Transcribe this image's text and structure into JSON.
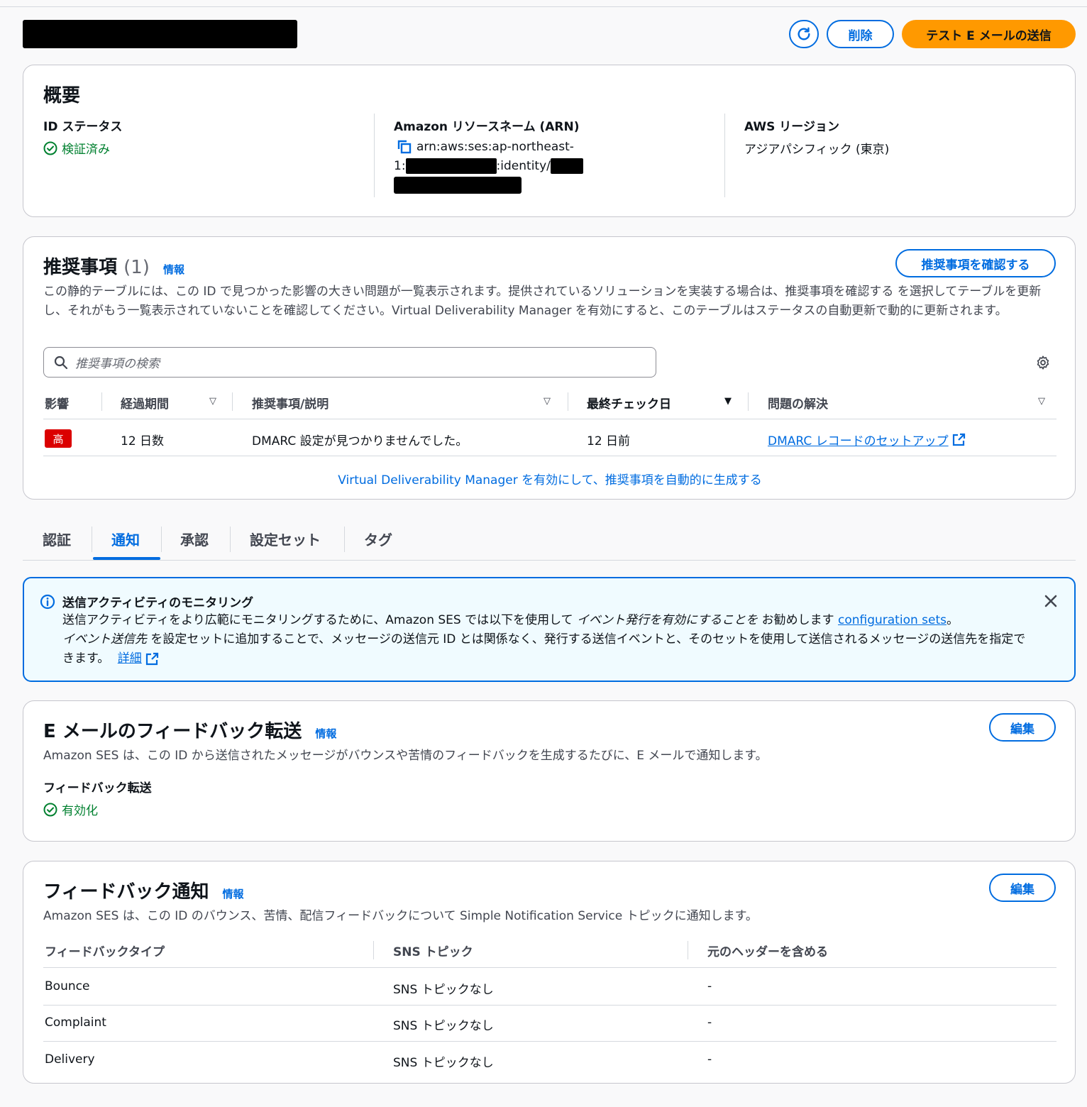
{
  "header": {
    "delete_label": "削除",
    "send_test_label": "テスト E メールの送信"
  },
  "summary": {
    "title": "概要",
    "status_label": "ID ステータス",
    "status_value": "検証済み",
    "arn_label": "Amazon リソースネーム (ARN)",
    "arn_line1": "arn:aws:ses:ap-northeast-",
    "arn_line2_prefix": "1:",
    "arn_line2_mid": ":identity/",
    "region_label": "AWS リージョン",
    "region_value": "アジアパシフィック (東京)"
  },
  "recommendations": {
    "title": "推奨事項",
    "count": "(1)",
    "info": "情報",
    "review_button": "推奨事項を確認する",
    "description": "この静的テーブルには、この ID で見つかった影響の大きい問題が一覧表示されます。提供されているソリューションを実装する場合は、推奨事項を確認する を選択してテーブルを更新し、それがもう一覧表示されていないことを確認してください。Virtual Deliverability Manager を有効にすると、このテーブルはステータスの自動更新で動的に更新されます。",
    "search_placeholder": "推奨事項の検索",
    "columns": [
      "影響",
      "経過期間",
      "推奨事項/説明",
      "最終チェック日",
      "問題の解決"
    ],
    "rows": [
      {
        "impact": "高",
        "age": "12 日数",
        "desc": "DMARC 設定が見つかりませんでした。",
        "last_check": "12 日前",
        "resolution": "DMARC レコードのセットアップ"
      }
    ],
    "vdm_link": "Virtual Deliverability Manager を有効にして、推奨事項を自動的に生成する"
  },
  "tabs": [
    "認証",
    "通知",
    "承認",
    "設定セット",
    "タグ"
  ],
  "alert": {
    "title": "送信アクティビティのモニタリング",
    "body_1": "送信アクティビティをより広範にモニタリングするために、Amazon SES では以下を使用して ",
    "body_em1": "イベント発行を有効にすることを",
    "body_2": " お勧めします ",
    "body_link": "configuration sets",
    "body_3": "。",
    "body_em2": "イベント送信先",
    "body_4": " を設定セットに追加することで、メッセージの送信元 ID とは関係なく、発行する送信イベントと、そのセットを使用して送信されるメッセージの送信先を指定できます。",
    "more_link": "詳細"
  },
  "forwarding": {
    "title": "E メールのフィードバック転送",
    "info": "情報",
    "edit": "編集",
    "description": "Amazon SES は、この ID から送信されたメッセージがバウンスや苦情のフィードバックを生成するたびに、E メールで通知します。",
    "label": "フィードバック転送",
    "value": "有効化"
  },
  "notifications": {
    "title": "フィードバック通知",
    "info": "情報",
    "edit": "編集",
    "description": "Amazon SES は、この ID のバウンス、苦情、配信フィードバックについて Simple Notification Service トピックに通知します。",
    "columns": [
      "フィードバックタイプ",
      "SNS トピック",
      "元のヘッダーを含める"
    ],
    "rows": [
      {
        "type": "Bounce",
        "topic": "SNS トピックなし",
        "headers": "-"
      },
      {
        "type": "Complaint",
        "topic": "SNS トピックなし",
        "headers": "-"
      },
      {
        "type": "Delivery",
        "topic": "SNS トピックなし",
        "headers": "-"
      }
    ]
  }
}
